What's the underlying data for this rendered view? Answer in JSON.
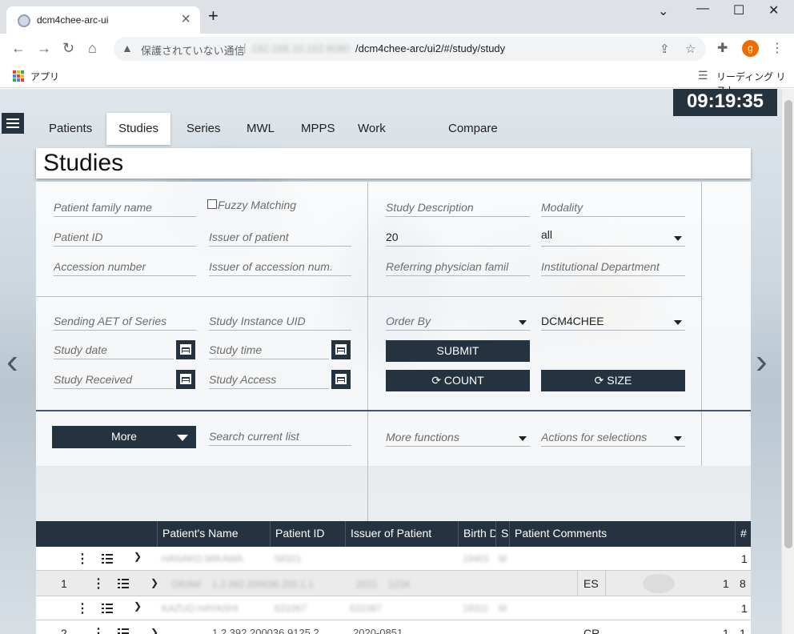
{
  "browser": {
    "tab_title": "dcm4chee-arc-ui",
    "new_tab_label": "+",
    "security_label": "保護されていない通信",
    "url_host": "192.168.10.162:8080",
    "url_path": "/dcm4chee-arc/ui2/#/study/study",
    "profile_initial": "g",
    "apps_label": "アプリ",
    "reading_list_label": "リーディング リスト"
  },
  "app": {
    "clock": "09:19:35",
    "tabs": [
      "Patients",
      "Studies",
      "Series",
      "MWL",
      "MPPS",
      "Work Items",
      "Compare"
    ],
    "active_tab": "Studies",
    "page_title": "Studies"
  },
  "form": {
    "patient_family_name": "Patient family name",
    "fuzzy_matching": "Fuzzy Matching",
    "patient_id": "Patient ID",
    "issuer_of_patient": "Issuer of patient",
    "accession_number": "Accession number",
    "issuer_of_accession": "Issuer of accession num.",
    "study_description": "Study Description",
    "modality": "Modality",
    "limit_value": "20",
    "modality_value": "all",
    "referring_physician": "Referring physician famil",
    "institutional_department": "Institutional Department",
    "sending_aet": "Sending AET of Series",
    "study_instance_uid": "Study Instance UID",
    "order_by": "Order By",
    "aet_value": "DCM4CHEE",
    "study_date": "Study date",
    "study_time": "Study time",
    "submit": "SUBMIT",
    "study_received": "Study Received",
    "study_access": "Study Access",
    "count": "COUNT",
    "size": "SIZE",
    "more": "More",
    "search_current_list": "Search current list",
    "more_functions": "More functions",
    "actions_for_selections": "Actions for selections"
  },
  "table": {
    "headers": [
      "Patient's Name",
      "Patient ID",
      "Issuer of Patient",
      "Birth Date",
      "S",
      "Patient Comments",
      "#"
    ],
    "rows": [
      {
        "type": "patient",
        "count": "1",
        "blur": [
          "HANAKO.MIKAWA",
          "58321",
          "",
          "19401",
          "M"
        ]
      },
      {
        "type": "study",
        "num": "1",
        "modality": "ES",
        "series": "1",
        "count": "8",
        "blur": [
          "DRAW",
          "1.2.392.200036.200.1.1",
          "2021",
          "1234"
        ]
      },
      {
        "type": "patient",
        "count": "1",
        "blur": [
          "KAZUO.HAYASHI",
          "631067",
          "631067",
          "19311",
          "M"
        ]
      },
      {
        "type": "study",
        "num": "2",
        "modality": "CR",
        "series": "1",
        "count": "1",
        "blur": [
          "1.2.392.200036.9125.2",
          "2020-0851"
        ]
      }
    ]
  },
  "colors": {
    "dark_navy": "#253341",
    "accent_orange": "#ef6c00"
  }
}
